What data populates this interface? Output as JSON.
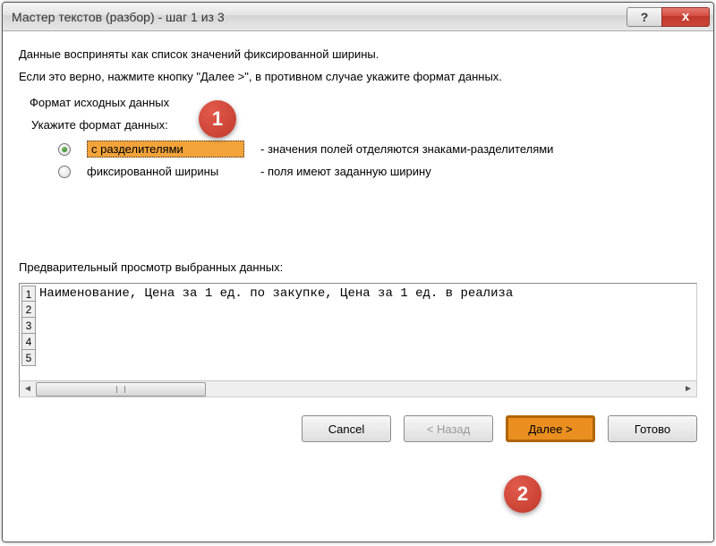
{
  "title": "Мастер текстов (разбор) - шаг 1 из 3",
  "intro1": "Данные восприняты как список значений фиксированной ширины.",
  "intro2": "Если это верно, нажмите кнопку \"Далее >\", в противном случае укажите формат данных.",
  "group_label": "Формат исходных данных",
  "radios_label": "Укажите формат данных:",
  "radio1": {
    "label": "с разделителями",
    "desc": "- значения полей отделяются знаками-разделителями"
  },
  "radio2": {
    "label": "фиксированной ширины",
    "desc": "- поля имеют заданную ширину"
  },
  "callouts": {
    "one": "1",
    "two": "2"
  },
  "preview_label": "Предварительный просмотр выбранных данных:",
  "preview_rows": {
    "r1": "Наименование, Цена за 1 ед. по закупке, Цена за 1 ед. в реализа",
    "r2": "",
    "r3": "",
    "r4": "",
    "r5": ""
  },
  "rownums": {
    "n1": "1",
    "n2": "2",
    "n3": "3",
    "n4": "4",
    "n5": "5"
  },
  "buttons": {
    "cancel": "Cancel",
    "back": "< Назад",
    "next": "Далее >",
    "finish": "Готово"
  },
  "titlebar": {
    "help": "?",
    "close": "x"
  }
}
